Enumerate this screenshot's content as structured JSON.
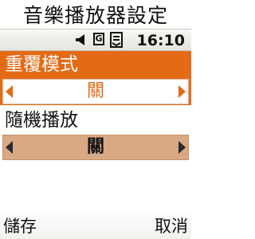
{
  "header": {
    "title": "音樂播放器設定"
  },
  "status": {
    "time": "16:10",
    "network_label": "G",
    "icons": [
      "speaker-icon",
      "network-icon",
      "message-icon"
    ]
  },
  "settings": [
    {
      "label": "重覆模式",
      "value": "關",
      "selected": true
    },
    {
      "label": "隨機播放",
      "value": "關",
      "selected": false
    }
  ],
  "softkeys": {
    "left": "儲存",
    "right": "取消"
  },
  "colors": {
    "accent": "#e46b16",
    "inactive_selector": "#d9a884",
    "status_bar": "#eeeeea"
  }
}
